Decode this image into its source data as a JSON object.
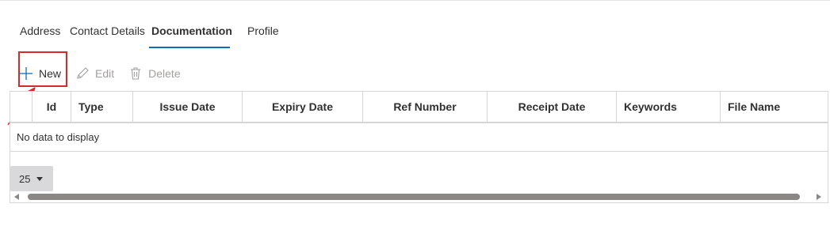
{
  "tabs": [
    {
      "label": "Address",
      "active": false
    },
    {
      "label": "Contact Details",
      "active": false
    },
    {
      "label": "Documentation",
      "active": true
    },
    {
      "label": "Profile",
      "active": false
    }
  ],
  "toolbar": {
    "new_label": "New",
    "edit_label": "Edit",
    "delete_label": "Delete"
  },
  "grid": {
    "columns": [
      "",
      "Id",
      "Type",
      "Issue Date",
      "Expiry Date",
      "Ref Number",
      "Receipt Date",
      "Keywords",
      "File Name"
    ],
    "empty_text": "No data to display",
    "page_size": "25"
  },
  "colors": {
    "accent": "#0f6cbd",
    "highlight": "#d42a2a",
    "disabled_text": "#a19f9d"
  }
}
